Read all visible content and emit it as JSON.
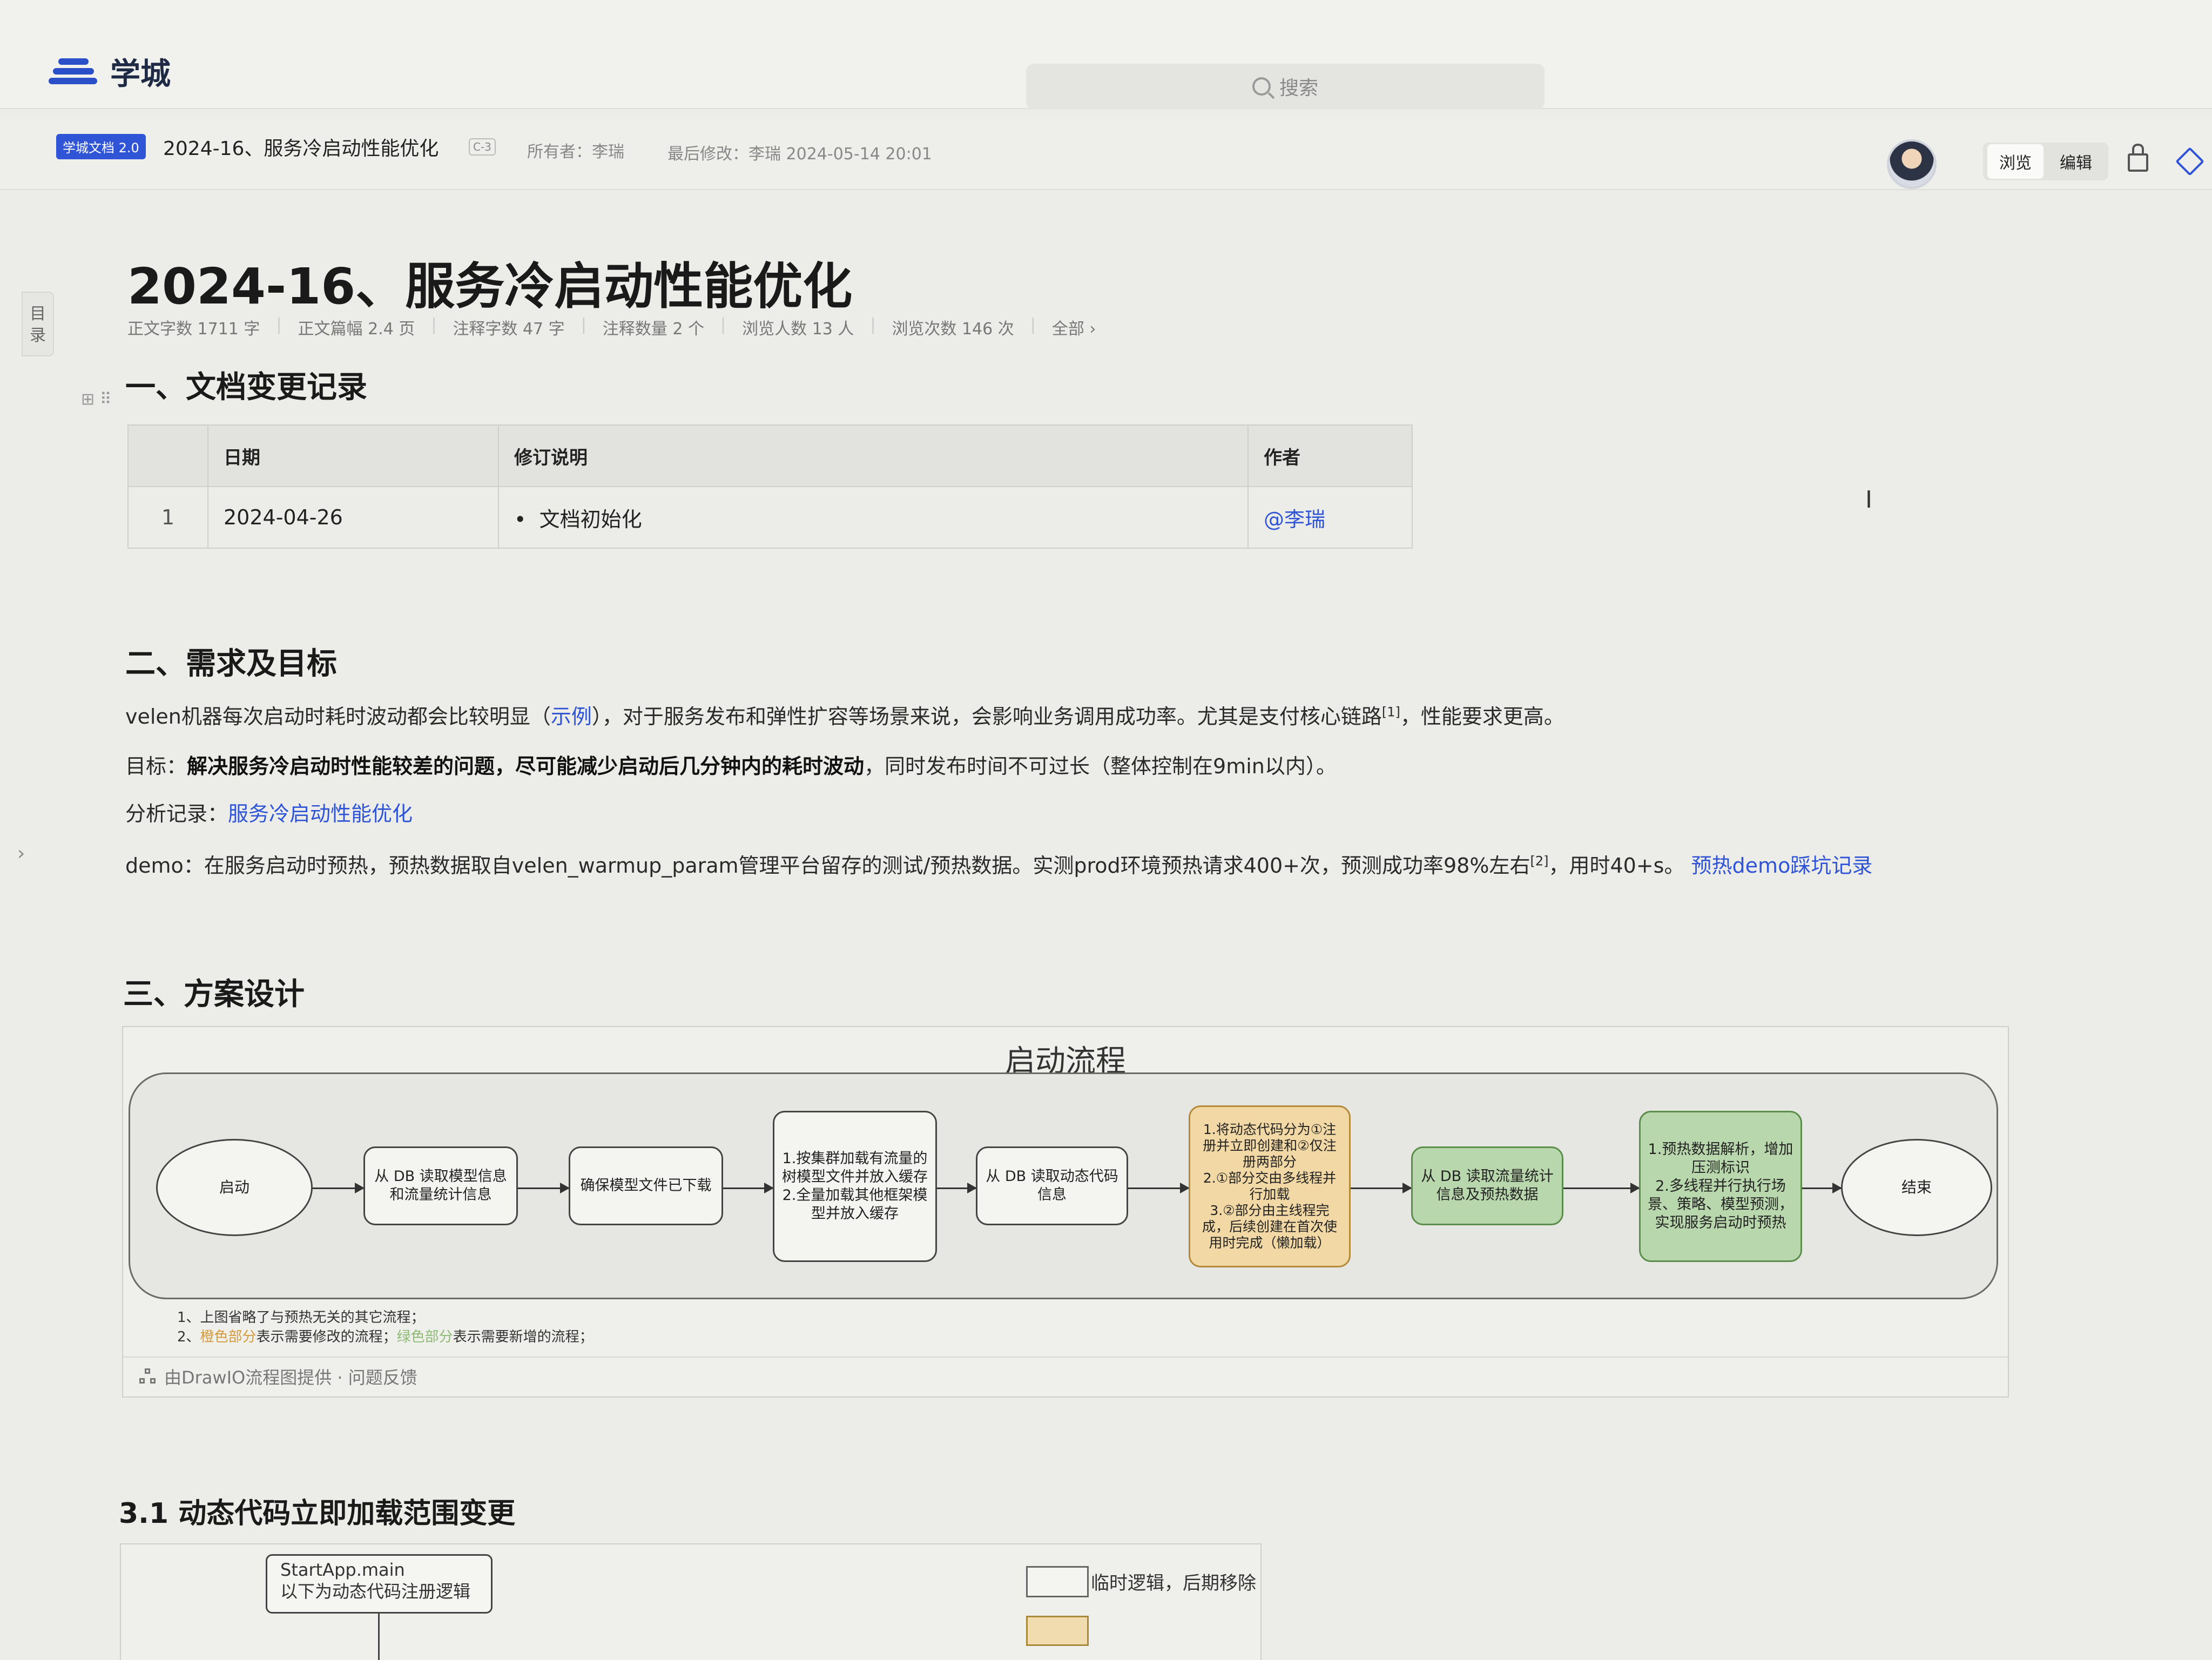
{
  "app": {
    "logo_text": "学城",
    "search_placeholder": "搜索"
  },
  "doc_header": {
    "badge": "学城文档 2.0",
    "title": "2024-16、服务冷启动性能优化",
    "security_level": "C-3",
    "owner": "所有者：李瑞",
    "last_modified": "最后修改：李瑞  2024-05-14 20:01",
    "mode_view": "浏览",
    "mode_edit": "编辑"
  },
  "toc_label": "目录",
  "page": {
    "title": "2024-16、服务冷启动性能优化",
    "stats": [
      "正文字数 1711 字",
      "正文篇幅 2.4 页",
      "注释字数 47 字",
      "注释数量 2 个",
      "浏览人数 13 人",
      "浏览次数 146 次",
      "全部 ›"
    ]
  },
  "section1": {
    "heading": "一、文档变更记录",
    "columns": [
      "",
      "日期",
      "修订说明",
      "作者"
    ],
    "rows": [
      {
        "index": "1",
        "date": "2024-04-26",
        "note": "文档初始化",
        "author": "@李瑞"
      }
    ]
  },
  "section2": {
    "heading": "二、需求及目标",
    "p1_a": "velen机器每次启动时耗时波动都会比较明显（",
    "p1_link": "示例",
    "p1_b": "），对于服务发布和弹性扩容等场景来说，会影响业务调用成功率。尤其是支付核心链路",
    "p1_sup": "[1]",
    "p1_c": "，性能要求更高。",
    "p2_label": "目标：",
    "p2_bold": "解决服务冷启动时性能较差的问题，尽可能减少启动后几分钟内的耗时波动",
    "p2_rest": "，同时发布时间不可过长（整体控制在9min以内）。",
    "p3_label": "分析记录：",
    "p3_link": "服务冷启动性能优化",
    "p4_a": "demo：在服务启动时预热，预热数据取自velen_warmup_param管理平台留存的测试/预热数据。实测prod环境预热请求400+次，预测成功率98%左右",
    "p4_sup": "[2]",
    "p4_b": "，用时40+s。",
    "p4_link": "预热demo踩坑记录"
  },
  "section3": {
    "heading": "三、方案设计",
    "diagram_title": "启动流程",
    "nodes": {
      "start": "启动",
      "n1": "从 DB 读取模型信息\n和流量统计信息",
      "n2": "确保模型文件已下载",
      "n3": "1.按集群加载有流量的\n树模型文件并放入缓存\n2.全量加载其他框架模\n型并放入缓存",
      "n4": "从 DB 读取动态代码\n信息",
      "n5": "1.将动态代码分为①注\n册并立即创建和②仅注\n册两部分\n2.①部分交由多线程并\n行加载\n3.②部分由主线程完\n成，后续创建在首次使\n用时完成（懒加载）",
      "n6": "从 DB 读取流量统计\n信息及预热数据",
      "n7": "1.预热数据解析，增加\n压测标识\n2.多线程并行执行场\n景、策略、模型预测，\n实现服务启动时预热",
      "end": "结束"
    },
    "note1": "1、上图省略了与预热无关的其它流程；",
    "note2_a": "2、",
    "note2_orange": "橙色部分",
    "note2_b": "表示需要修改的流程；",
    "note2_green": "绿色部分",
    "note2_c": "表示需要新增的流程；",
    "footer": "由DrawIO流程图提供 · 问题反馈",
    "colors": {
      "orange": "#f2d8a4",
      "green": "#b9d7ac"
    }
  },
  "section31": {
    "heading": "3.1 动态代码立即加载范围变更",
    "box_line1": "StartApp.main",
    "box_line2": "以下为动态代码注册逻辑",
    "legend_label": "临时逻辑，后期移除"
  }
}
